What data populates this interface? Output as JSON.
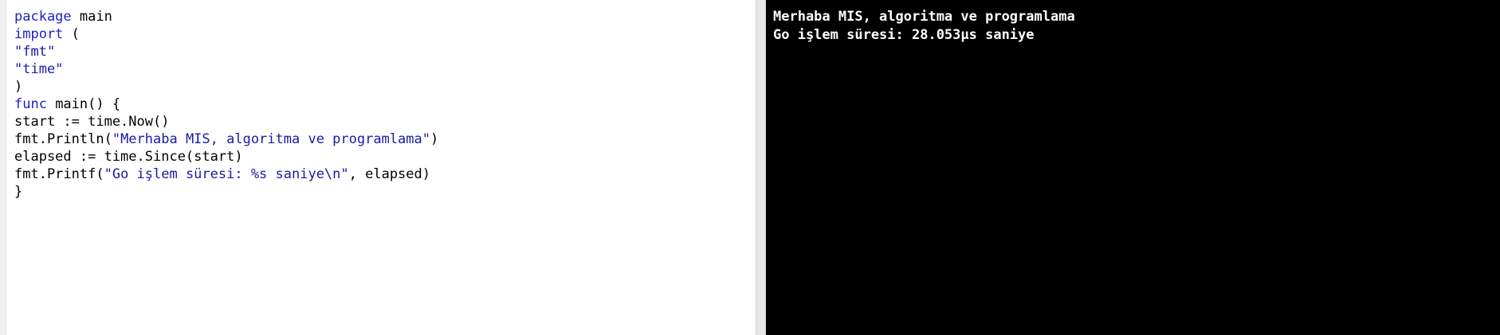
{
  "editor": {
    "lines": [
      [
        {
          "t": "package",
          "c": "kw"
        },
        {
          "t": " main",
          "c": ""
        }
      ],
      [
        {
          "t": "import",
          "c": "kw"
        },
        {
          "t": " (",
          "c": ""
        }
      ],
      [
        {
          "t": "\"fmt\"",
          "c": "str"
        }
      ],
      [
        {
          "t": "\"time\"",
          "c": "str"
        }
      ],
      [
        {
          "t": ")",
          "c": ""
        }
      ],
      [
        {
          "t": "func",
          "c": "kw"
        },
        {
          "t": " main() {",
          "c": ""
        }
      ],
      [
        {
          "t": "start := time.Now()",
          "c": ""
        }
      ],
      [
        {
          "t": "fmt.Println(",
          "c": ""
        },
        {
          "t": "\"Merhaba MIS, algoritma ve programlama\"",
          "c": "str"
        },
        {
          "t": ")",
          "c": ""
        }
      ],
      [
        {
          "t": "elapsed := time.Since(start)",
          "c": ""
        }
      ],
      [
        {
          "t": "fmt.Printf(",
          "c": ""
        },
        {
          "t": "\"Go işlem süresi: %s saniye\\n\"",
          "c": "str"
        },
        {
          "t": ", elapsed)",
          "c": ""
        }
      ],
      [
        {
          "t": "}",
          "c": ""
        }
      ]
    ]
  },
  "console": {
    "lines": [
      "Merhaba MIS, algoritma ve programlama",
      "Go işlem süresi: 28.053µs saniye"
    ]
  },
  "colors": {
    "keyword": "#1f1fbf",
    "string": "#1a1aa6",
    "console_bg": "#000000",
    "console_fg": "#ffffff"
  }
}
